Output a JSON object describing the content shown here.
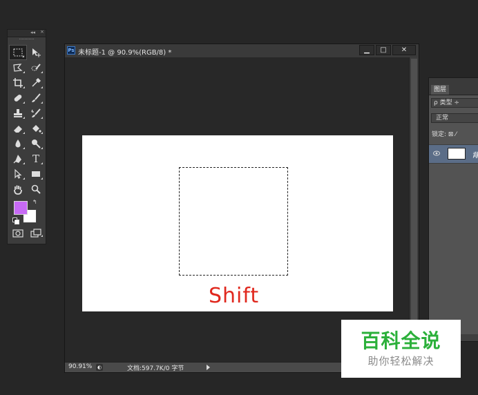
{
  "tools_panel": {
    "collapse_glyph": "◂◂",
    "close_glyph": "×",
    "type_tool_glyph": "T",
    "foreground_color": "#c76af5",
    "background_color": "#ffffff",
    "swap_glyph": "↰"
  },
  "document": {
    "title": "未标题-1 @ 90.9%(RGB/8) *",
    "ps_logo": "Ps",
    "minimize_glyph": "▁",
    "maximize_glyph": "□",
    "close_glyph": "✕",
    "canvas_text": "Shift",
    "canvas_text_color": "#e0281e",
    "status": {
      "zoom": "90.91%",
      "doc_info": "文档:597.7K/0 字节"
    }
  },
  "layers_panel": {
    "tab_label": "图层",
    "filter_label": "ρ 类型 ÷",
    "blend_mode": "正常",
    "lock_label": "锁定: ⊠ ⁄",
    "layer_name": "背"
  },
  "watermark": {
    "title": "百科全说",
    "subtitle": "助你轻松解决"
  }
}
